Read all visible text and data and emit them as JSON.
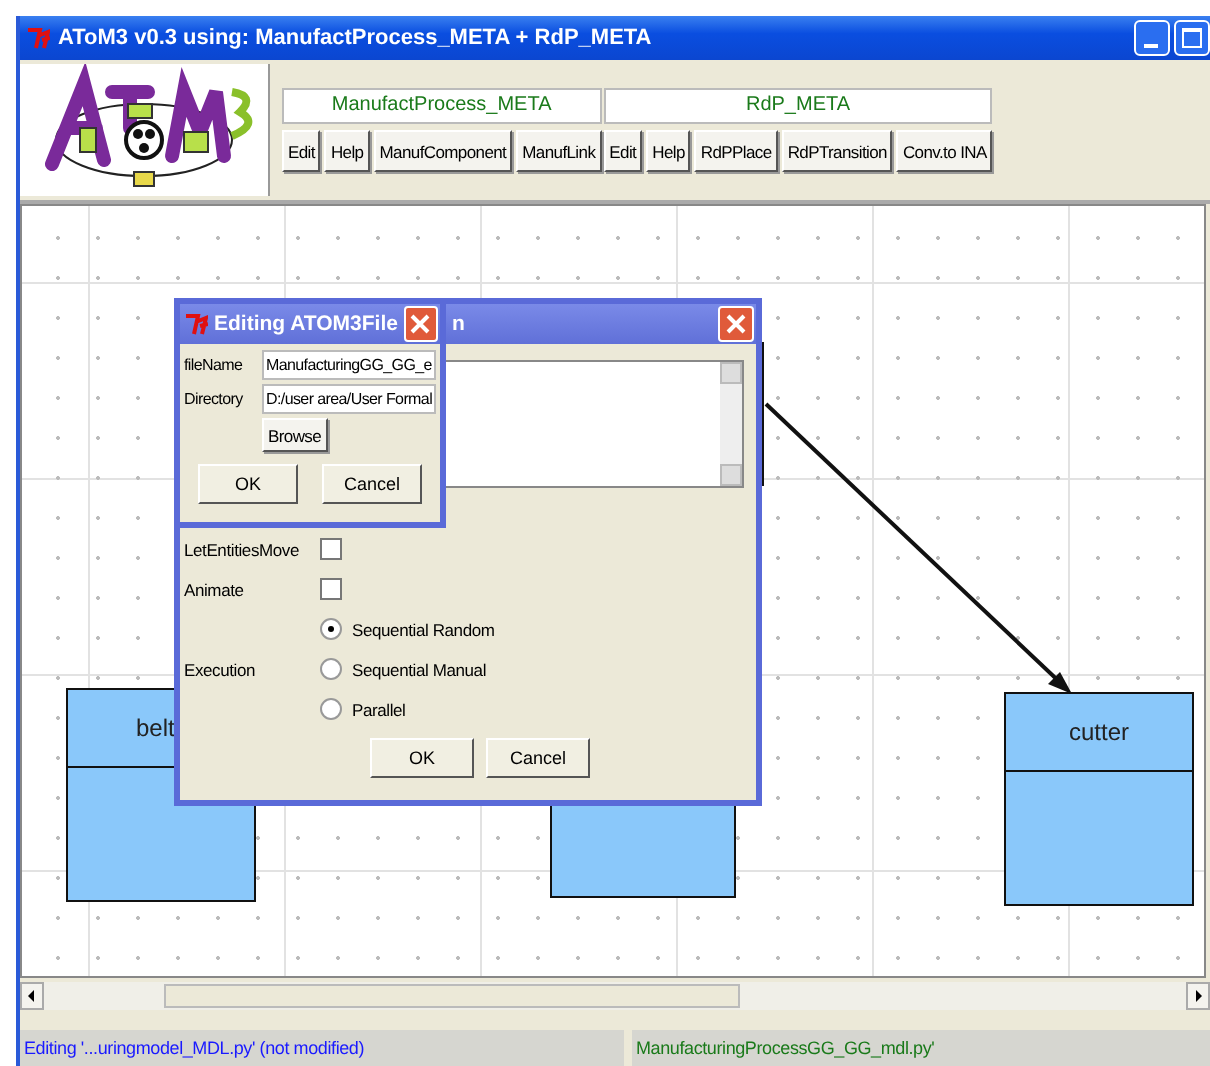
{
  "window": {
    "title": "AToM3 v0.3 using: ManufactProcess_META + RdP_META"
  },
  "toolbar": {
    "groups": [
      {
        "title": "ManufactProcess_META",
        "buttons": [
          "Edit",
          "Help",
          "ManufComponent",
          "ManufLink"
        ]
      },
      {
        "title": "RdP_META",
        "buttons": [
          "Edit",
          "Help",
          "RdPPlace",
          "RdPTransition",
          "Conv.to INA"
        ]
      }
    ]
  },
  "canvas": {
    "nodes": [
      {
        "label": "belt",
        "kind": "full"
      },
      {
        "kind": "partial"
      },
      {
        "label": "cutter",
        "kind": "full"
      }
    ]
  },
  "options_dialog": {
    "title": "n",
    "options": [
      {
        "label": "LetEntitiesMove",
        "checked": false
      },
      {
        "label": "Animate",
        "checked": false
      }
    ],
    "execution": {
      "label": "Execution",
      "choices": [
        {
          "label": "Sequential Random",
          "selected": true
        },
        {
          "label": "Sequential Manual",
          "selected": false
        },
        {
          "label": "Parallel",
          "selected": false
        }
      ]
    },
    "buttons": [
      "OK",
      "Cancel"
    ]
  },
  "file_dialog": {
    "title": "Editing ATOM3File",
    "fields": [
      {
        "label": "fileName",
        "value": "ManufacturingGG_GG_e"
      },
      {
        "label": "Directory",
        "value": "D:/user area/User Formal"
      }
    ],
    "browse": "Browse",
    "buttons": [
      "OK",
      "Cancel"
    ]
  },
  "status_bar": [
    {
      "text": "Editing '...uringmodel_MDL.py' (not modified)",
      "color": "#1a1aff"
    },
    {
      "text": "ManufacturingProcessGG_GG_mdl.py'",
      "color": "#1a7a1a"
    }
  ]
}
